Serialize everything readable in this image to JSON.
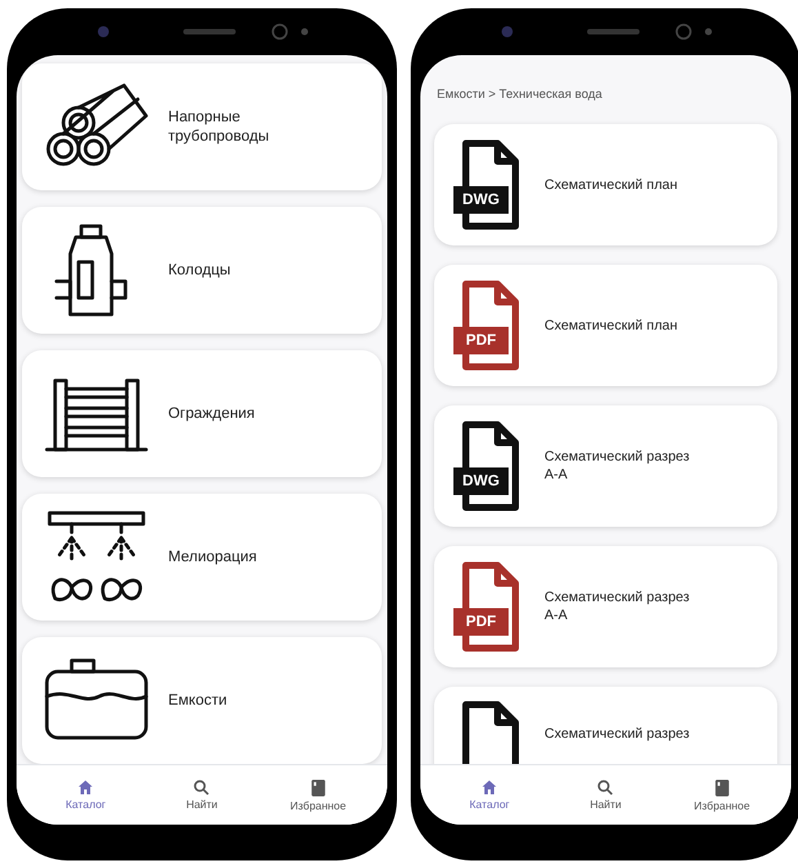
{
  "catalog_screen": {
    "items": [
      {
        "kind": "pipes",
        "label": "Напорные трубопроводы"
      },
      {
        "kind": "well",
        "label": "Колодцы"
      },
      {
        "kind": "fence",
        "label": "Ограждения"
      },
      {
        "kind": "irrigation",
        "label": "Мелиорация"
      },
      {
        "kind": "tank",
        "label": "Емкости"
      }
    ],
    "nav": [
      {
        "kind": "home",
        "label": "Каталог",
        "selected": true
      },
      {
        "kind": "search",
        "label": "Найти",
        "selected": false
      },
      {
        "kind": "bookmark",
        "label": "Избранное",
        "selected": false
      }
    ]
  },
  "files_screen": {
    "breadcrumb": "Емкости > Техническая вода",
    "files": [
      {
        "format": "DWG",
        "color": "#111111",
        "label": "Схематический план"
      },
      {
        "format": "PDF",
        "color": "#a8312b",
        "label": "Схематический план"
      },
      {
        "format": "DWG",
        "color": "#111111",
        "label": "Схематический разрез А-А"
      },
      {
        "format": "PDF",
        "color": "#a8312b",
        "label": "Схематический разрез А-А"
      },
      {
        "color": "#111111",
        "label": "Схематический разрез"
      }
    ],
    "nav": [
      {
        "kind": "home",
        "label": "Каталог",
        "selected": true
      },
      {
        "kind": "search",
        "label": "Найти",
        "selected": false
      },
      {
        "kind": "bookmark",
        "label": "Избранное",
        "selected": false
      }
    ]
  }
}
